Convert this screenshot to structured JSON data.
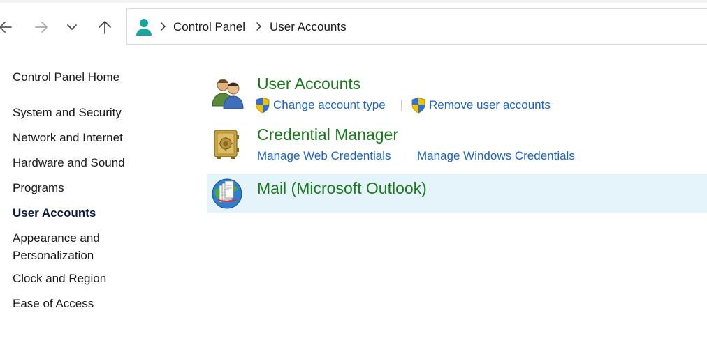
{
  "nav": {
    "back_icon": "arrow-left-icon",
    "forward_icon": "arrow-right-icon",
    "recent_icon": "chevron-down-icon",
    "up_icon": "arrow-up-icon"
  },
  "breadcrumb": {
    "root_icon": "user-accounts-icon",
    "items": [
      "Control Panel",
      "User Accounts"
    ]
  },
  "sidebar": {
    "home": "Control Panel Home",
    "items": [
      "System and Security",
      "Network and Internet",
      "Hardware and Sound",
      "Programs",
      "User Accounts",
      "Appearance and Personalization",
      "Clock and Region",
      "Ease of Access"
    ],
    "active": "User Accounts"
  },
  "categories": [
    {
      "title": "User Accounts",
      "icon": "users-icon",
      "links": [
        "Change account type",
        "Remove user accounts"
      ]
    },
    {
      "title": "Credential Manager",
      "icon": "vault-icon",
      "links": [
        "Manage Web Credentials",
        "Manage Windows Credentials"
      ]
    },
    {
      "title": "Mail (Microsoft Outlook)",
      "icon": "mail-icon",
      "links": []
    }
  ],
  "colors": {
    "category_title": "#1c7a1c",
    "link": "#1b64c4",
    "hover_highlight": "#e5f3fb"
  }
}
